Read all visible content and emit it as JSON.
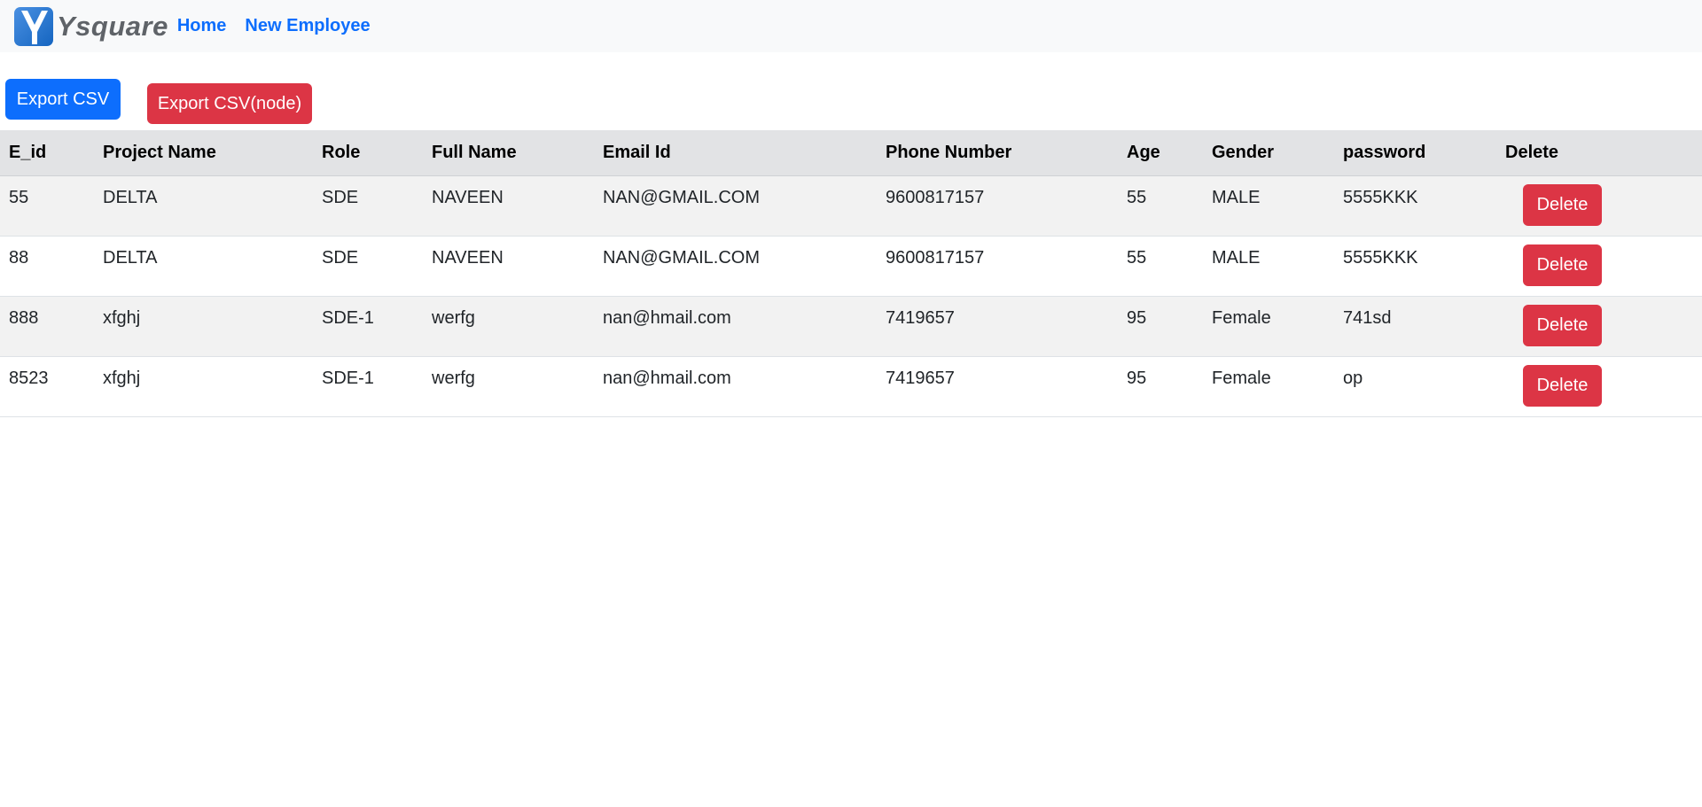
{
  "navbar": {
    "brand": "Ysquare",
    "links": [
      "Home",
      "New Employee"
    ]
  },
  "actions": {
    "export_csv": "Export CSV",
    "export_csv_node": "Export CSV(node)"
  },
  "table": {
    "headers": [
      "E_id",
      "Project Name",
      "Role",
      "Full Name",
      "Email Id",
      "Phone Number",
      "Age",
      "Gender",
      "password",
      "Delete"
    ],
    "rows": [
      [
        "55",
        "DELTA",
        "SDE",
        "NAVEEN",
        "NAN@GMAIL.COM",
        "9600817157",
        "55",
        "MALE",
        "5555KKK"
      ],
      [
        "88",
        "DELTA",
        "SDE",
        "NAVEEN",
        "NAN@GMAIL.COM",
        "9600817157",
        "55",
        "MALE",
        "5555KKK"
      ],
      [
        "888",
        "xfghj",
        "SDE-1",
        "werfg",
        "nan@hmail.com",
        "7419657",
        "95",
        "Female",
        "741sd"
      ],
      [
        "8523",
        "xfghj",
        "SDE-1",
        "werfg",
        "nan@hmail.com",
        "7419657",
        "95",
        "Female",
        "op"
      ]
    ],
    "delete_label": "Delete"
  },
  "colors": {
    "primary": "#0d6efd",
    "danger": "#dc3545",
    "navbar_bg": "#f8f9fa",
    "header_bg": "#e2e3e5"
  },
  "icons": {
    "logo": "ysquare-logo-icon"
  }
}
